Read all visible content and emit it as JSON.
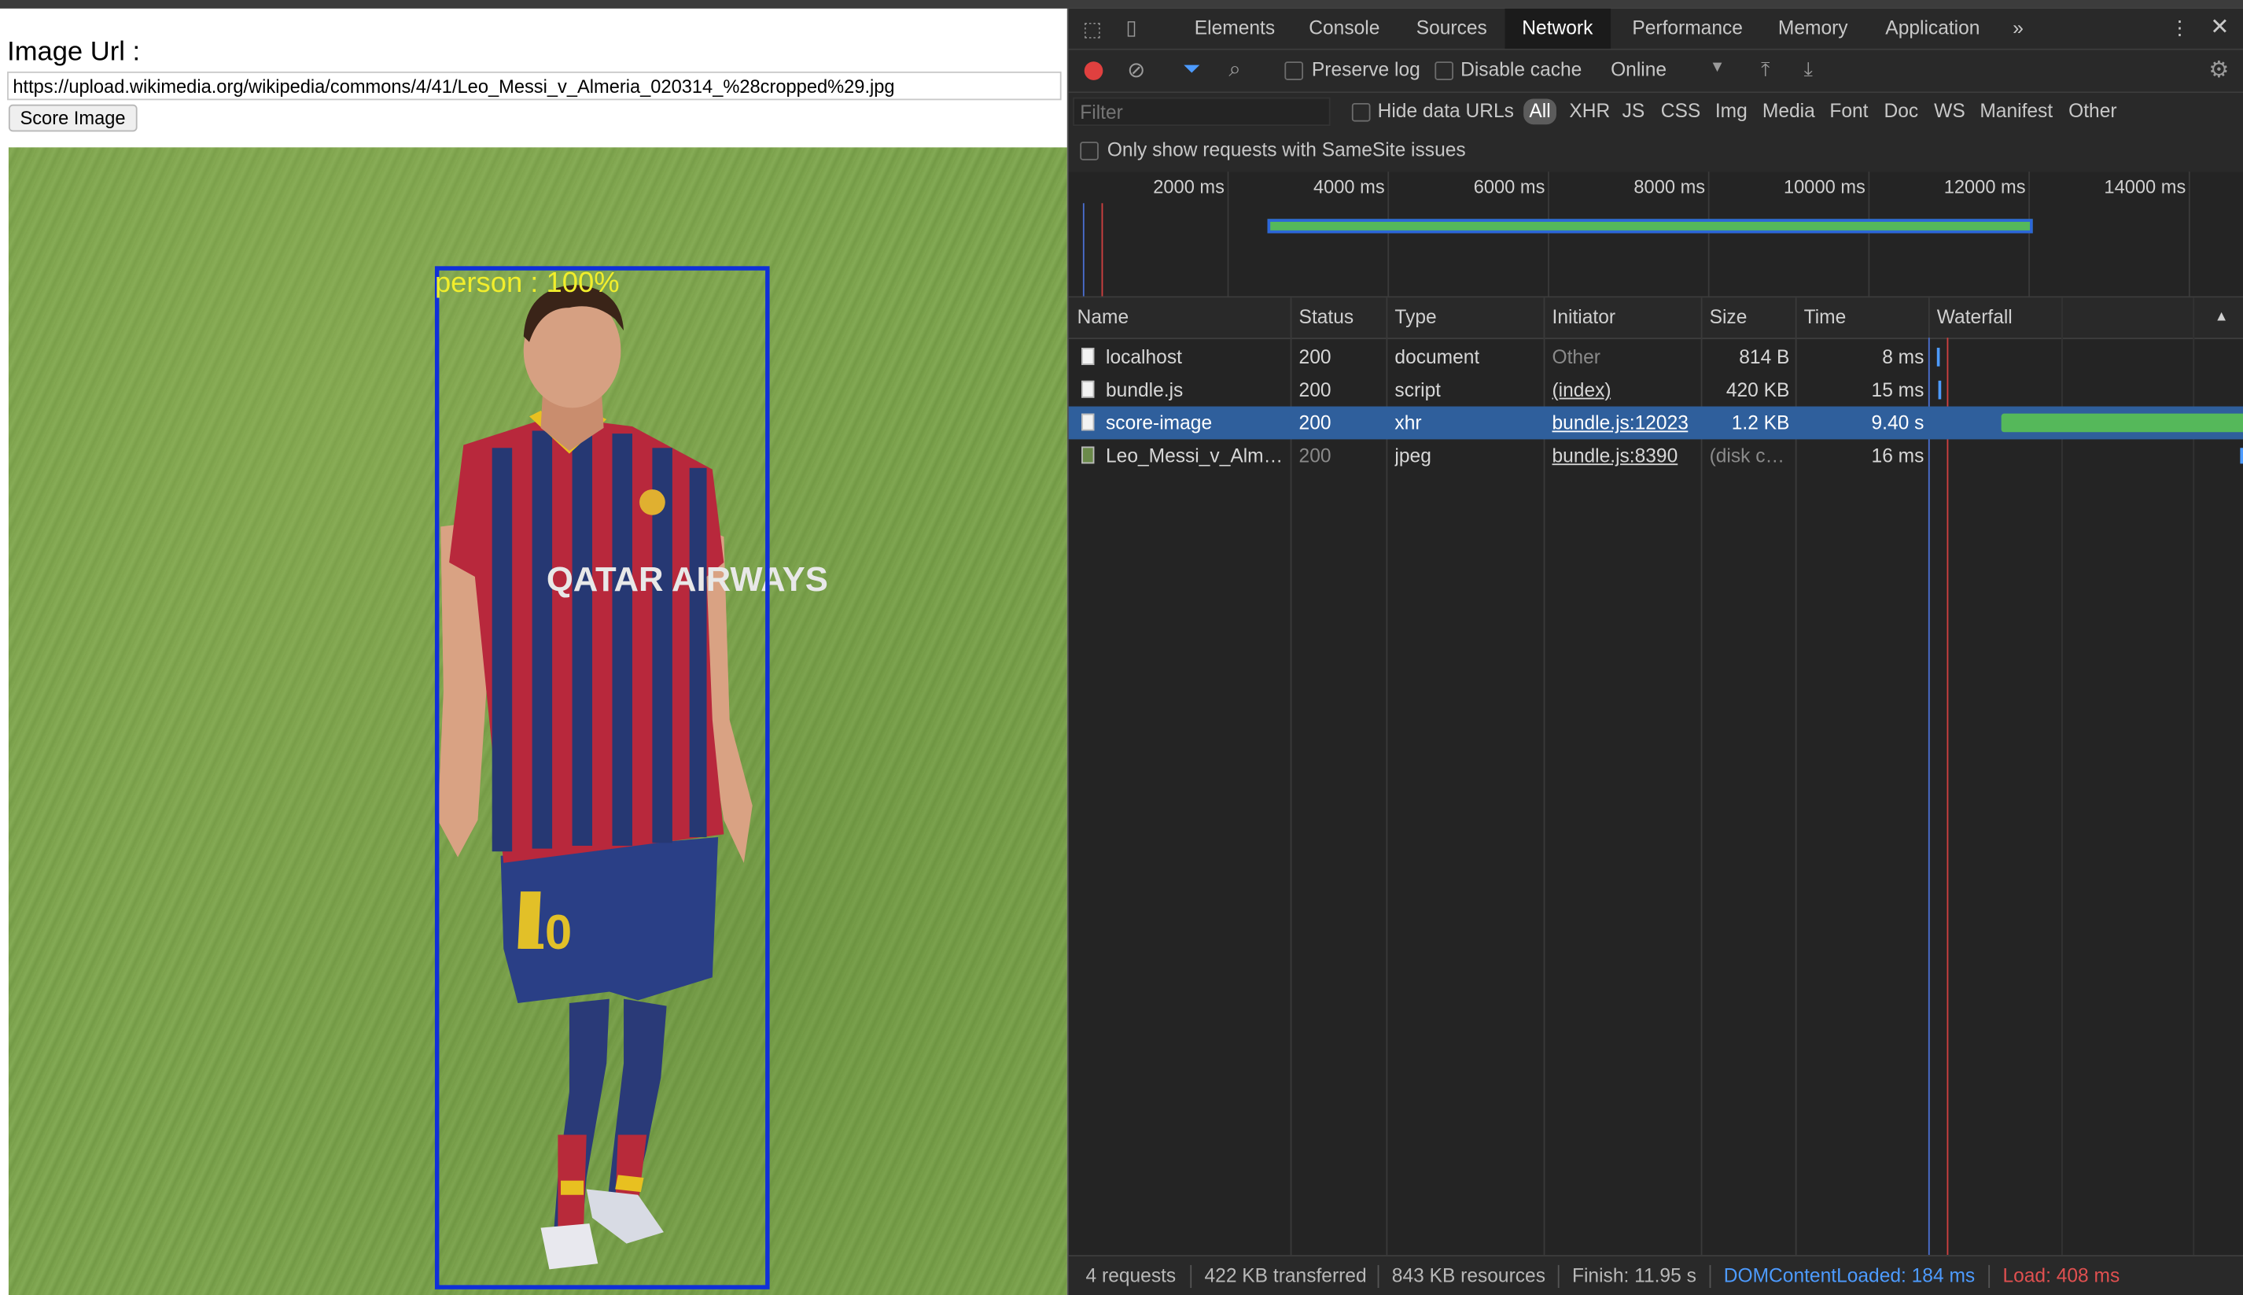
{
  "page": {
    "label": "Image Url :",
    "url_value": "https://upload.wikimedia.org/wikipedia/commons/4/41/Leo_Messi_v_Almeria_020314_%28cropped%29.jpg",
    "score_button": "Score Image",
    "detection_label": "person : 100%",
    "jersey_sponsor": "QATAR AIRWAYS",
    "jersey_number": "10"
  },
  "devtools": {
    "tabs": [
      "Elements",
      "Console",
      "Sources",
      "Network",
      "Performance",
      "Memory",
      "Application"
    ],
    "active_tab": "Network",
    "more_tabs_icon": "chevrons-right-icon",
    "toolbar": {
      "preserve_log": "Preserve log",
      "disable_cache": "Disable cache",
      "throttling": "Online"
    },
    "filter": {
      "placeholder": "Filter",
      "hide_data_urls": "Hide data URLs",
      "types": [
        "All",
        "XHR",
        "JS",
        "CSS",
        "Img",
        "Media",
        "Font",
        "Doc",
        "WS",
        "Manifest",
        "Other"
      ],
      "active_type": "All",
      "samesite": "Only show requests with SameSite issues"
    },
    "overview_ticks": [
      "2000 ms",
      "4000 ms",
      "6000 ms",
      "8000 ms",
      "10000 ms",
      "12000 ms",
      "14000 ms"
    ],
    "columns": [
      "Name",
      "Status",
      "Type",
      "Initiator",
      "Size",
      "Time",
      "Waterfall"
    ],
    "requests": [
      {
        "name": "localhost",
        "status": "200",
        "type": "document",
        "initiator": "Other",
        "size": "814 B",
        "time": "8 ms"
      },
      {
        "name": "bundle.js",
        "status": "200",
        "type": "script",
        "initiator": "(index)",
        "size": "420 KB",
        "time": "15 ms"
      },
      {
        "name": "score-image",
        "status": "200",
        "type": "xhr",
        "initiator": "bundle.js:12023",
        "size": "1.2 KB",
        "time": "9.40 s"
      },
      {
        "name": "Leo_Messi_v_Alm…",
        "status": "200",
        "type": "jpeg",
        "initiator": "bundle.js:8390",
        "size": "(disk c…",
        "time": "16 ms"
      }
    ],
    "status_bar": {
      "requests": "4 requests",
      "transferred": "422 KB transferred",
      "resources": "843 KB resources",
      "finish": "Finish: 11.95 s",
      "dom_content_loaded": "DOMContentLoaded: 184 ms",
      "load": "Load: 408 ms"
    },
    "colors": {
      "record": "#e0403f",
      "selected_row": "#2f5f9c",
      "waterfall_bar": "#55b85a",
      "dcl": "#4d9bff",
      "load": "#e05050"
    }
  }
}
